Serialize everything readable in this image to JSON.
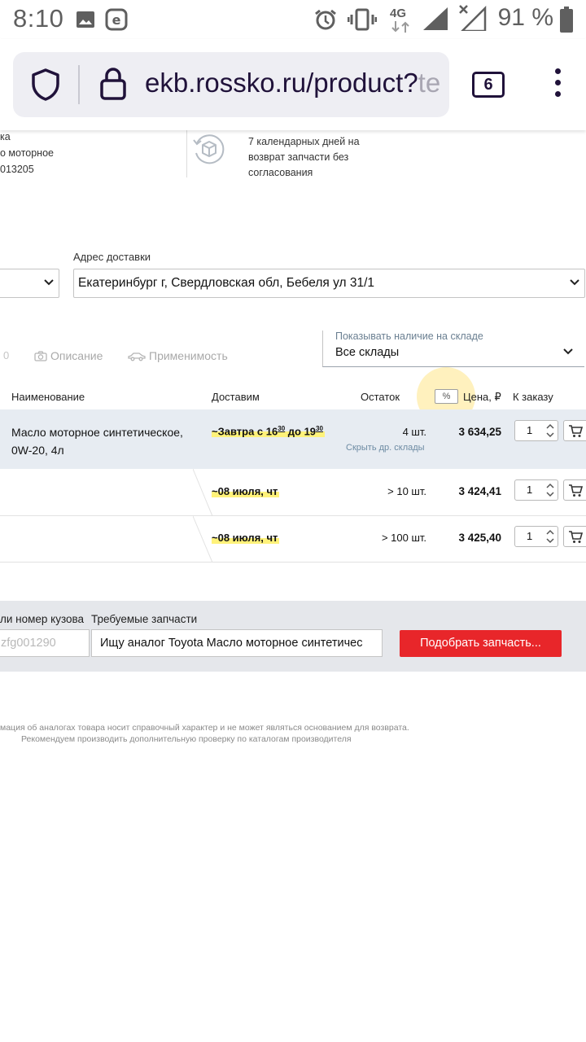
{
  "status_bar": {
    "time": "8:10",
    "network": "4G",
    "battery": "91 %",
    "icons": [
      "image-icon",
      "e-app-icon",
      "alarm-icon",
      "vibrate-icon",
      "signal-icon",
      "no-signal-icon",
      "battery-icon"
    ]
  },
  "browser": {
    "url_main": "ekb.rossko.ru/product?",
    "url_faded": "te",
    "tab_count": "6"
  },
  "info": {
    "product_lines": [
      "ка",
      "о моторное",
      "013205"
    ],
    "return_text": "7 календарных дней на возврат запчасти без согласования"
  },
  "delivery": {
    "label": "Адрес доставки",
    "address": "Екатеринбург г, Свердловская обл, Бебеля ул 31/1"
  },
  "tabs": {
    "zero": "0",
    "description": "Описание",
    "applicability": "Применимость"
  },
  "stock_filter": {
    "label": "Показывать наличие на складе",
    "value": "Все склады"
  },
  "table": {
    "headers": {
      "name": "Наименование",
      "delivery": "Доставим",
      "stock": "Остаток",
      "percent": "%",
      "price": "Цена, ₽",
      "order": "К заказу"
    },
    "rows": [
      {
        "name": "Масло моторное синтетическое, 0W-20, 4л",
        "delivery_prefix": "~Завтра с 16",
        "delivery_sup1": "30",
        "delivery_mid": " до 19",
        "delivery_sup2": "30",
        "stock": "4 шт.",
        "hide_link": "Скрыть др. склады",
        "price": "3 634,25",
        "qty": "1"
      },
      {
        "delivery": "~08 июля, чт",
        "stock": "> 10 шт.",
        "price": "3 424,41",
        "qty": "1"
      },
      {
        "delivery": "~08 июля, чт",
        "stock": "> 100 шт.",
        "price": "3 425,40",
        "qty": "1"
      }
    ]
  },
  "request": {
    "vin_label": "ли номер кузова",
    "vin_placeholder": "zfg001290",
    "parts_label": "Требуемые запчасти",
    "parts_value": "Ищу аналог Toyota Масло моторное синтетичес",
    "button": "Подобрать запчасть..."
  },
  "disclaimer": {
    "line1": "мация об аналогах товара носит справочный характер и не может являться основанием для возврата.",
    "line2": "Рекомендуем производить дополнительную проверку по каталогам производителя"
  }
}
